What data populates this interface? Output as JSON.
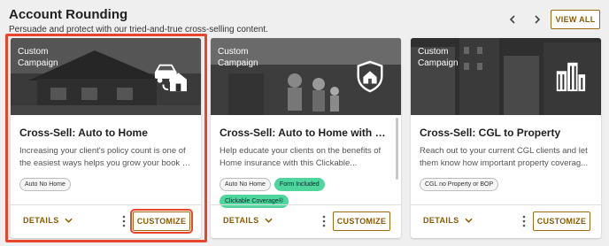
{
  "header": {
    "title": "Account Rounding",
    "subtitle": "Persuade and protect with our tried-and-true cross-selling content.",
    "view_all_label": "VIEW ALL"
  },
  "colors": {
    "accent": "#8a5a00",
    "highlight": "#e9452c",
    "tag_green": "#4fd69c"
  },
  "cards": [
    {
      "campaign_label": "Custom Campaign",
      "icon": "car-home-icon",
      "title": "Cross-Sell: Auto to Home",
      "description_lines": [
        "Increasing your client's policy count is one of",
        "the easiest ways helps you grow your book o..."
      ],
      "tags": [
        "Auto No Home"
      ],
      "details_label": "DETAILS",
      "customize_label": "CUSTOMIZE"
    },
    {
      "campaign_label": "Custom Campaign",
      "icon": "shield-home-icon",
      "title": "Cross-Sell: Auto to Home with Cli...",
      "description_lines": [
        "Help educate your clients on the benefits of",
        "Home insurance with this Clickable..."
      ],
      "tags": [
        "Auto No Home",
        "Form Included",
        "Clickable Coverage®"
      ],
      "details_label": "DETAILS",
      "customize_label": "CUSTOMIZE"
    },
    {
      "campaign_label": "Custom Campaign",
      "icon": "buildings-icon",
      "title": "Cross-Sell: CGL to Property",
      "description_lines": [
        "Reach out to your current CGL clients and let",
        "them know how important property coverag..."
      ],
      "tags": [
        "CGL no Property or BOP"
      ],
      "details_label": "DETAILS",
      "customize_label": "CUSTOMIZE"
    }
  ]
}
